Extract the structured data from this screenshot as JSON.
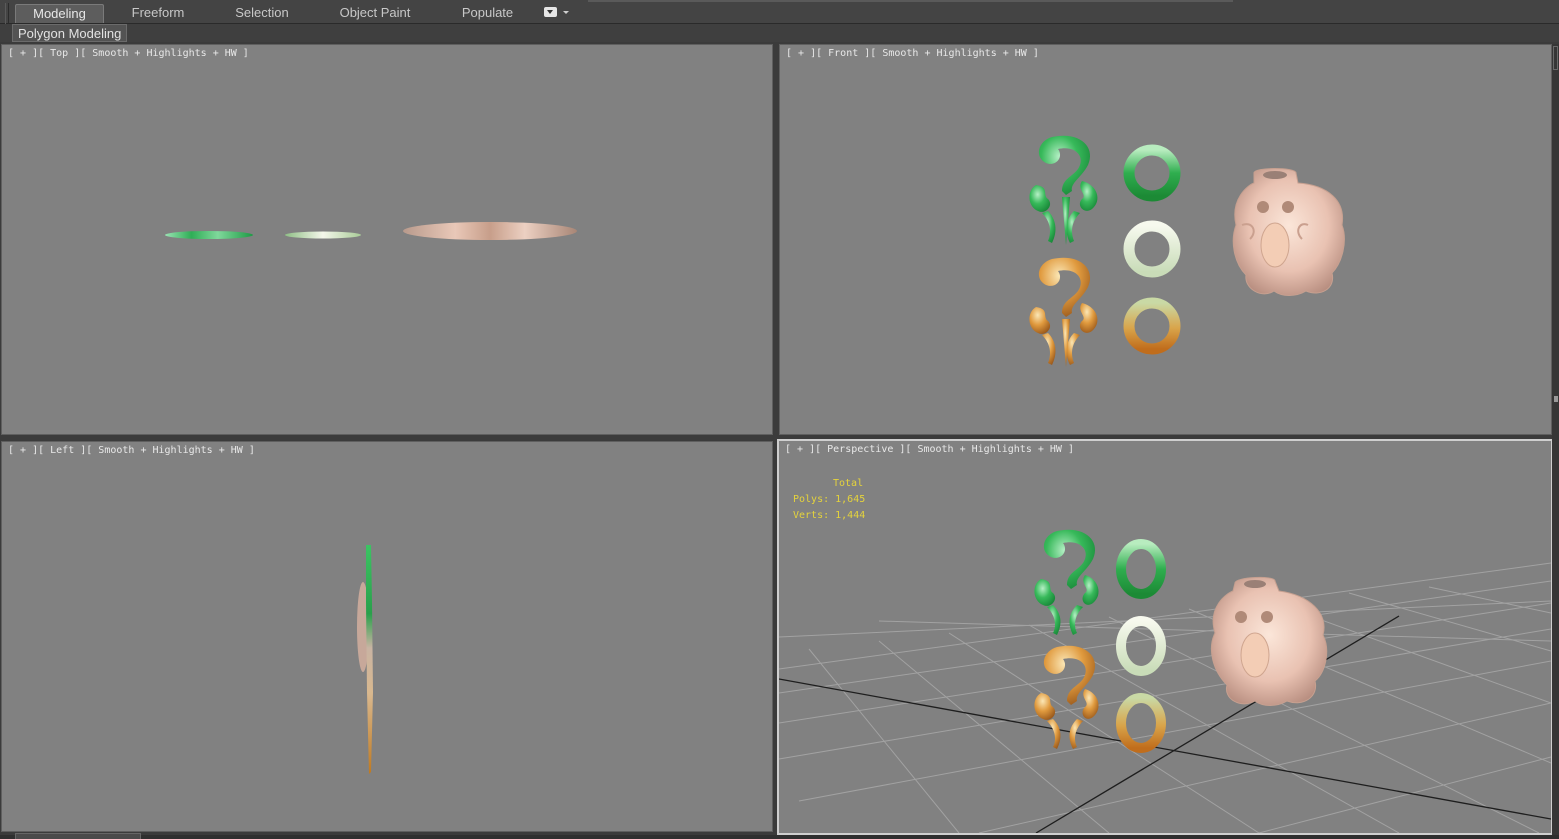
{
  "ribbon": {
    "tabs": [
      {
        "label": "Modeling",
        "active": true
      },
      {
        "label": "Freeform",
        "active": false
      },
      {
        "label": "Selection",
        "active": false
      },
      {
        "label": "Object Paint",
        "active": false
      },
      {
        "label": "Populate",
        "active": false
      }
    ],
    "more_icon": "dropdown-toggle-icon",
    "panel_label": "Polygon Modeling"
  },
  "viewports": {
    "top": {
      "label": "[ + ][ Top ][ Smooth + Highlights + HW ]"
    },
    "front": {
      "label": "[ + ][ Front ][ Smooth + Highlights + HW ]"
    },
    "left": {
      "label": "[ + ][ Left ][ Smooth + Highlights + HW ]"
    },
    "perspective": {
      "label": "[ + ][ Perspective ][ Smooth + Highlights + HW ]",
      "active": true
    }
  },
  "stats": {
    "title": "Total",
    "polys": "Polys: 1,645",
    "verts": "Verts: 1,444"
  },
  "colors": {
    "viewport_bg": "#818181",
    "stats_text": "#e5d33c",
    "jade_green": "#3fbf5f",
    "jade_white": "#dfe8cf",
    "jade_amber": "#d98a2e",
    "jade_pink": "#e7c3b6"
  }
}
